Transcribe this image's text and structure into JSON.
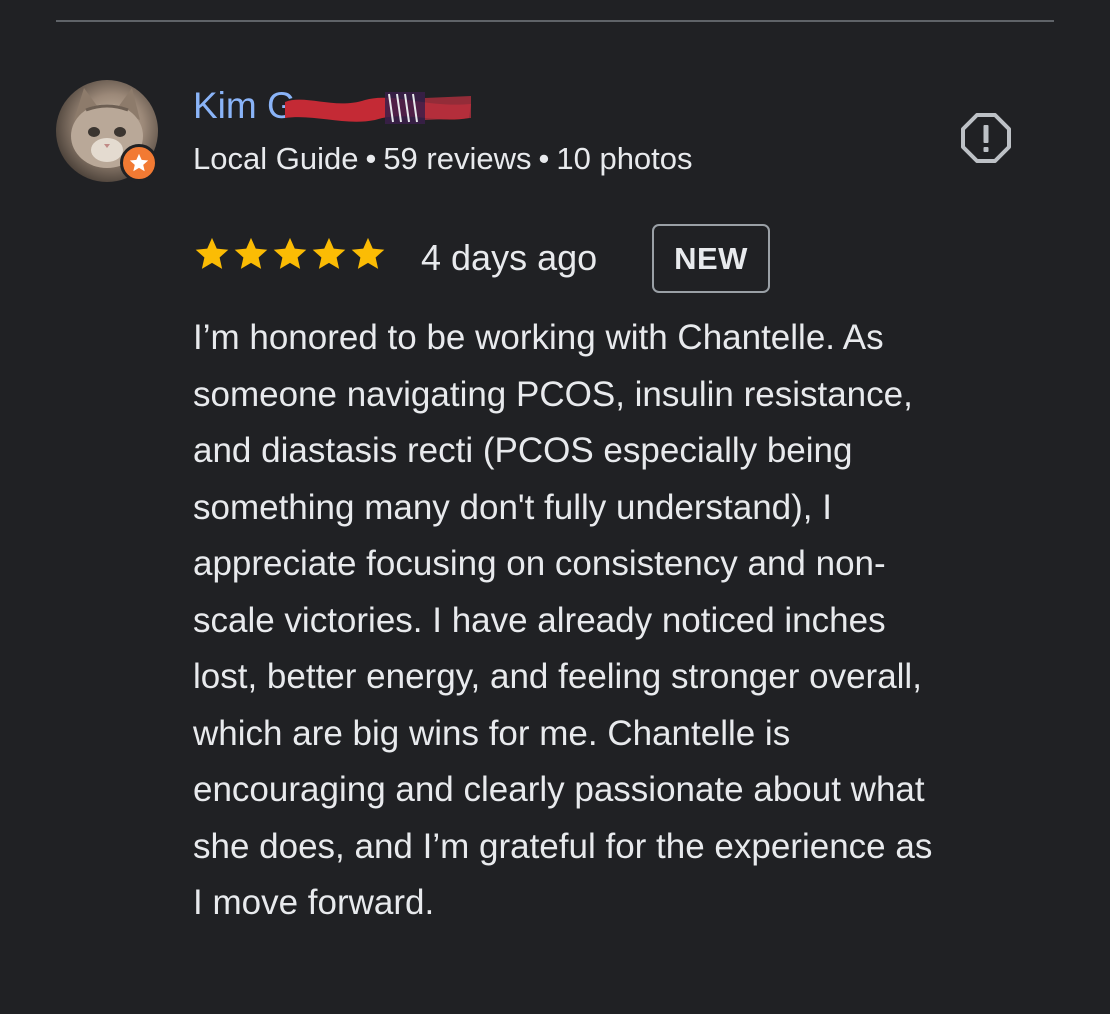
{
  "review": {
    "author": {
      "name": "Kim G",
      "badge_icon": "local-guide-star-icon",
      "role": "Local Guide",
      "reviews": "59 reviews",
      "photos": "10 photos",
      "separator": "•"
    },
    "rating": {
      "stars": 5,
      "max": 5
    },
    "date": "4 days ago",
    "badge": "NEW",
    "report_icon": "report-icon",
    "text_lines": [
      "I’m honored to be working with Chantelle. As",
      "someone navigating PCOS, insulin resistance,",
      "and diastasis recti (PCOS especially being",
      "something many don't fully understand), I",
      "appreciate focusing on consistency and non-",
      "scale victories. I have already noticed inches",
      "lost, better energy, and feeling stronger overall,",
      "which are big wins for me. Chantelle is",
      "encouraging and clearly passionate about what",
      "she does, and I’m grateful for the experience as",
      "I move forward."
    ]
  },
  "colors": {
    "background": "#202124",
    "author_name": "#8ab4f8",
    "star": "#fbbc04",
    "badge_orange": "#f27a33",
    "text": "#e8eaed"
  }
}
